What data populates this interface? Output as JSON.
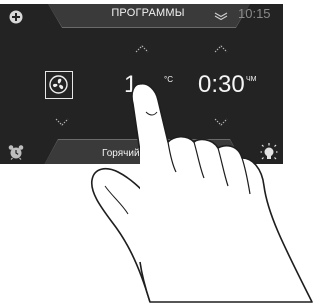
{
  "header": {
    "title": "ПРОГРАММЫ",
    "time": "10:15"
  },
  "icons": {
    "top_left": "add-circle-icon",
    "top_right": "double-chevron-down-icon",
    "bottom_left": "alarm-clock-icon",
    "bottom_right": "lamp-icon",
    "mode": "fan-icon"
  },
  "controls": {
    "temperature": {
      "value": "1",
      "unit": "°C"
    },
    "timer": {
      "value": "0:30",
      "unit": "ЧМ"
    }
  },
  "footer": {
    "mode_label": "Горячий во"
  }
}
